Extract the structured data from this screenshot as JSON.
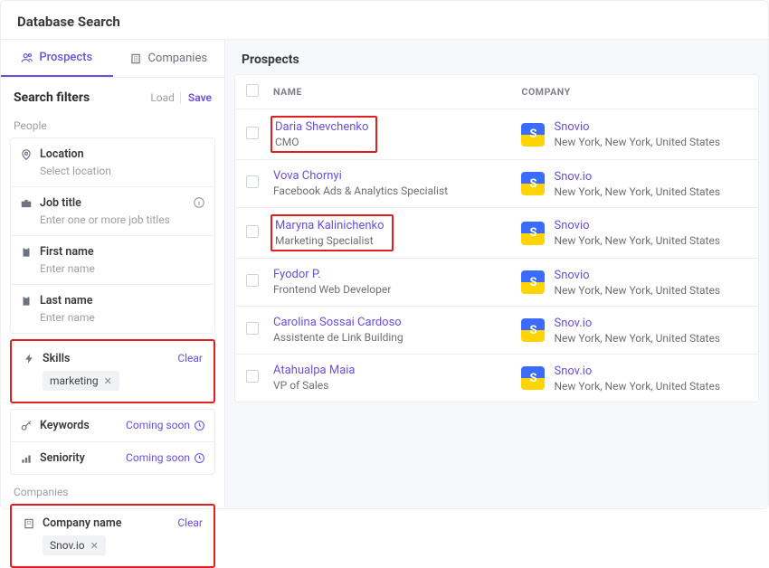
{
  "header": {
    "title": "Database Search"
  },
  "tabs": {
    "prospects": "Prospects",
    "companies": "Companies"
  },
  "filters": {
    "title": "Search filters",
    "load": "Load",
    "save": "Save",
    "people_label": "People",
    "companies_label": "Companies",
    "location": {
      "label": "Location",
      "placeholder": "Select location"
    },
    "job_title": {
      "label": "Job title",
      "placeholder": "Enter one or more job titles"
    },
    "first_name": {
      "label": "First name",
      "placeholder": "Enter name"
    },
    "last_name": {
      "label": "Last name",
      "placeholder": "Enter name"
    },
    "skills": {
      "label": "Skills",
      "clear": "Clear",
      "chip": "marketing"
    },
    "keywords": {
      "label": "Keywords",
      "coming": "Coming soon"
    },
    "seniority": {
      "label": "Seniority",
      "coming": "Coming soon"
    },
    "company_name": {
      "label": "Company name",
      "clear": "Clear",
      "chip": "Snov.io"
    }
  },
  "main": {
    "title": "Prospects",
    "columns": {
      "name": "NAME",
      "company": "COMPANY"
    },
    "rows": [
      {
        "name": "Daria Shevchenko",
        "title": "CMO",
        "company": "Snovio",
        "location": "New York, New York, United States",
        "logo": "S",
        "hl": true
      },
      {
        "name": "Vova Chornyi",
        "title": "Facebook Ads & Analytics Specialist",
        "company": "Snov.io",
        "location": "New York, New York, United States",
        "logo": "S",
        "hl": false
      },
      {
        "name": "Maryna Kalinichenko",
        "title": "Marketing Specialist",
        "company": "Snovio",
        "location": "New York, New York, United States",
        "logo": "S",
        "hl": true
      },
      {
        "name": "Fyodor P.",
        "title": "Frontend Web Developer",
        "company": "Snovio",
        "location": "New York, New York, United States",
        "logo": "S",
        "hl": false
      },
      {
        "name": "Carolina Sossai Cardoso",
        "title": "Assistente de Link Building",
        "company": "Snov.io",
        "location": "New York, New York, United States",
        "logo": "S",
        "hl": false
      },
      {
        "name": "Atahualpa Maia",
        "title": "VP of Sales",
        "company": "Snov.io",
        "location": "New York, New York, United States",
        "logo": "S",
        "hl": false
      }
    ]
  }
}
